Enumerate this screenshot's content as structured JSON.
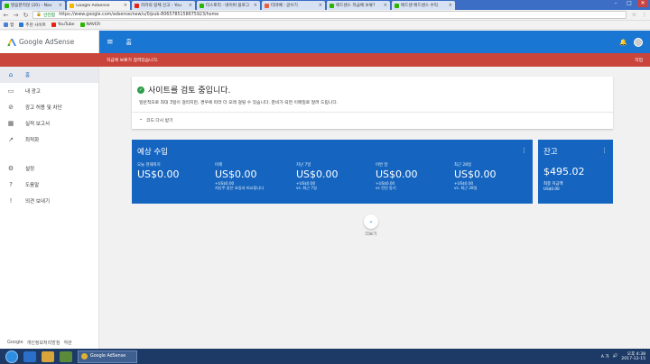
{
  "browser": {
    "tabs": [
      {
        "title": "발음분지않 (20) - Nav",
        "color": "#2db400"
      },
      {
        "title": "Google AdSense",
        "color": "#f4b400",
        "active": true
      },
      {
        "title": "카카의 링체 신고 - You",
        "color": "#e62117"
      },
      {
        "title": "티스토리 · 네이버 블로그",
        "color": "#2db400"
      },
      {
        "title": "티마베 : 글쓰기",
        "color": "#e8603c"
      },
      {
        "title": "애드센스 지급에 보류?",
        "color": "#2db400"
      },
      {
        "title": "애드센 애드센스 수익",
        "color": "#2db400"
      }
    ],
    "window_controls": [
      "–",
      "□",
      "✕"
    ],
    "address": {
      "secure_label": "안전함",
      "url": "https://www.google.com/adsense/new/u/0/pub-8065785158675923/home"
    },
    "bookmarks": [
      {
        "label": "앱",
        "color": "#4a7fd6"
      },
      {
        "label": "추천 사이트",
        "color": "#2a78d4"
      },
      {
        "label": "YouTube",
        "color": "#e62117"
      },
      {
        "label": "NAVER",
        "color": "#2db400"
      }
    ]
  },
  "sidebar": {
    "brand": "Google AdSense",
    "items": [
      {
        "label": "홈",
        "icon": "home-icon",
        "glyph": "⌂",
        "active": true
      },
      {
        "label": "내 광고",
        "icon": "ads-icon",
        "glyph": "▭"
      },
      {
        "label": "광고 허용 및 차단",
        "icon": "block-icon",
        "glyph": "⊘"
      },
      {
        "label": "실적 보고서",
        "icon": "report-icon",
        "glyph": "▦"
      },
      {
        "label": "최적화",
        "icon": "trend-icon",
        "glyph": "↗"
      },
      {
        "label": "설정",
        "icon": "gear-icon",
        "glyph": "⚙"
      },
      {
        "label": "도움말",
        "icon": "help-icon",
        "glyph": "?"
      },
      {
        "label": "의견 보내기",
        "icon": "feedback-icon",
        "glyph": "!"
      }
    ],
    "footer": [
      "Google",
      "개인정보처리방침",
      "약관"
    ]
  },
  "topbar": {
    "title": "홈"
  },
  "alert": {
    "message": "지급에 보류가 걸려있습니다.",
    "action": "작업"
  },
  "review_card": {
    "title": "사이트를 검토 중입니다.",
    "description": "일반적으로 최대 3일이 걸리지만, 경우에 따라 더 오래 걸릴 수 있습니다. 준비가 되면 이메일로 알려 드립니다.",
    "code_link": "코드 다시 받기"
  },
  "earnings": {
    "title": "예상 수입",
    "columns": [
      {
        "label": "오늘 현재까지",
        "value": "US$0.00",
        "sub": "",
        "sub2": ""
      },
      {
        "label": "어제",
        "value": "US$0.00",
        "sub": "+US$0.00",
        "sub2": "지난주 같은 요일과 비교합니다"
      },
      {
        "label": "지난 7일",
        "value": "US$0.00",
        "sub": "+US$0.00",
        "sub2": "vs. 최근 7일"
      },
      {
        "label": "이번 달",
        "value": "US$0.00",
        "sub": "+US$0.00",
        "sub2": "vs 전년 동기"
      },
      {
        "label": "최근 28일",
        "value": "US$0.00",
        "sub": "+US$0.00",
        "sub2": "vs. 최근 28일"
      }
    ]
  },
  "balance": {
    "title": "잔고",
    "value": "$495.02",
    "label": "최종 지급액",
    "sub": "US$0.00"
  },
  "more_label": "더보기",
  "taskbar": {
    "task_label": "Google AdSense",
    "time": "오후 4:38",
    "date": "2017-12-15",
    "lang": "A 가"
  },
  "colors": {
    "primary": "#1976d2",
    "card_blue": "#1565c0",
    "alert_red": "#c9443b",
    "success_green": "#2e9d4a"
  }
}
